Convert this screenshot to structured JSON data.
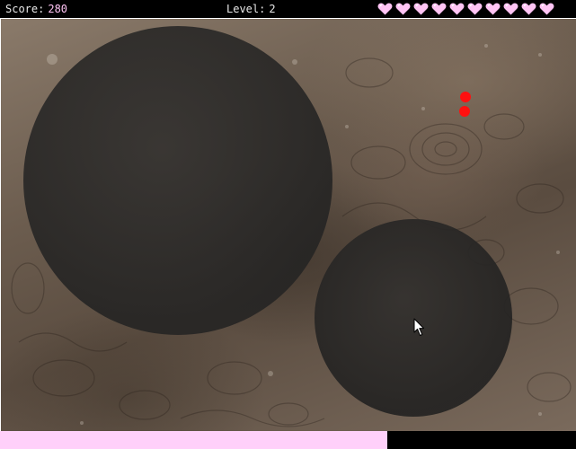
{
  "hud": {
    "score_label": "Score:",
    "score_value": "280",
    "level_label": "Level:",
    "level_value": "2",
    "lives": 10
  },
  "progress": {
    "fraction": 0.672
  },
  "colors": {
    "heart": "#ffc4f4",
    "progress": "#ffd0fa",
    "enemy_dot": "#ff1010",
    "hud_background": "#000000",
    "dark_zone": "#2a2928"
  },
  "icons": {
    "heart": "heart-icon",
    "cursor": "mouse-pointer-icon"
  }
}
